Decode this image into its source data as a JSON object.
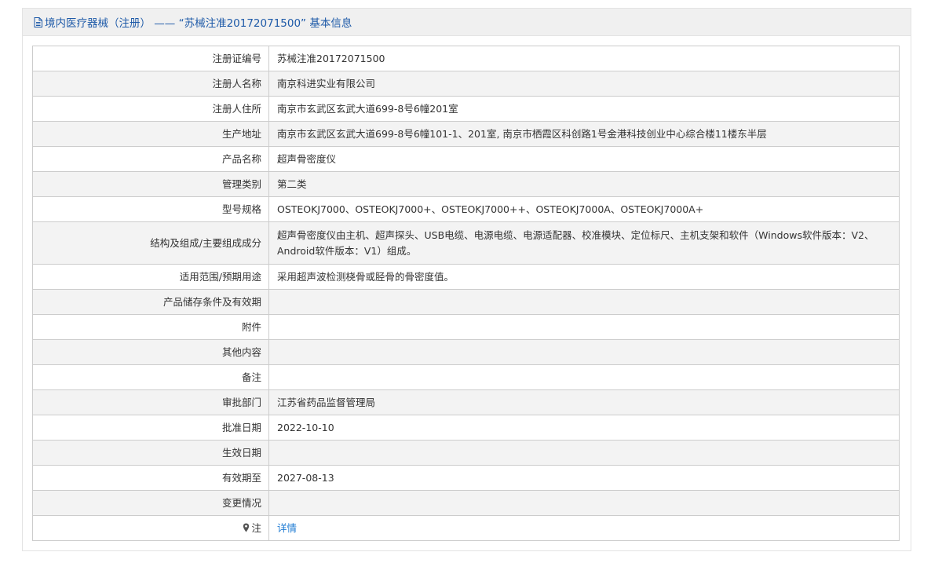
{
  "header": {
    "title": "境内医疗器械（注册） —— “苏械注准20172071500” 基本信息",
    "icon": "document-icon",
    "color": "#1e5aa8"
  },
  "rows": [
    {
      "label": "注册证编号",
      "value": "苏械注准20172071500"
    },
    {
      "label": "注册人名称",
      "value": "南京科进实业有限公司"
    },
    {
      "label": "注册人住所",
      "value": "南京市玄武区玄武大道699-8号6幢201室"
    },
    {
      "label": "生产地址",
      "value": "南京市玄武区玄武大道699-8号6幢101-1、201室, 南京市栖霞区科创路1号金港科技创业中心综合楼11楼东半层"
    },
    {
      "label": "产品名称",
      "value": "超声骨密度仪"
    },
    {
      "label": "管理类别",
      "value": "第二类"
    },
    {
      "label": "型号规格",
      "value": "OSTEOKJ7000、OSTEOKJ7000+、OSTEOKJ7000++、OSTEOKJ7000A、OSTEOKJ7000A+"
    },
    {
      "label": "结构及组成/主要组成成分",
      "value": "超声骨密度仪由主机、超声探头、USB电缆、电源电缆、电源适配器、校准模块、定位标尺、主机支架和软件（Windows软件版本：V2、Android软件版本：V1）组成。"
    },
    {
      "label": "适用范围/预期用途",
      "value": "采用超声波检测桡骨或胫骨的骨密度值。"
    },
    {
      "label": "产品储存条件及有效期",
      "value": ""
    },
    {
      "label": "附件",
      "value": ""
    },
    {
      "label": "其他内容",
      "value": ""
    },
    {
      "label": "备注",
      "value": ""
    },
    {
      "label": "审批部门",
      "value": "江苏省药品监督管理局"
    },
    {
      "label": "批准日期",
      "value": "2022-10-10"
    },
    {
      "label": "生效日期",
      "value": ""
    },
    {
      "label": "有效期至",
      "value": "2027-08-13"
    },
    {
      "label": "变更情况",
      "value": ""
    }
  ],
  "note_row": {
    "icon": "map-pin-icon",
    "label": "注",
    "link_text": "详情",
    "link_color": "#1e7bd3"
  }
}
